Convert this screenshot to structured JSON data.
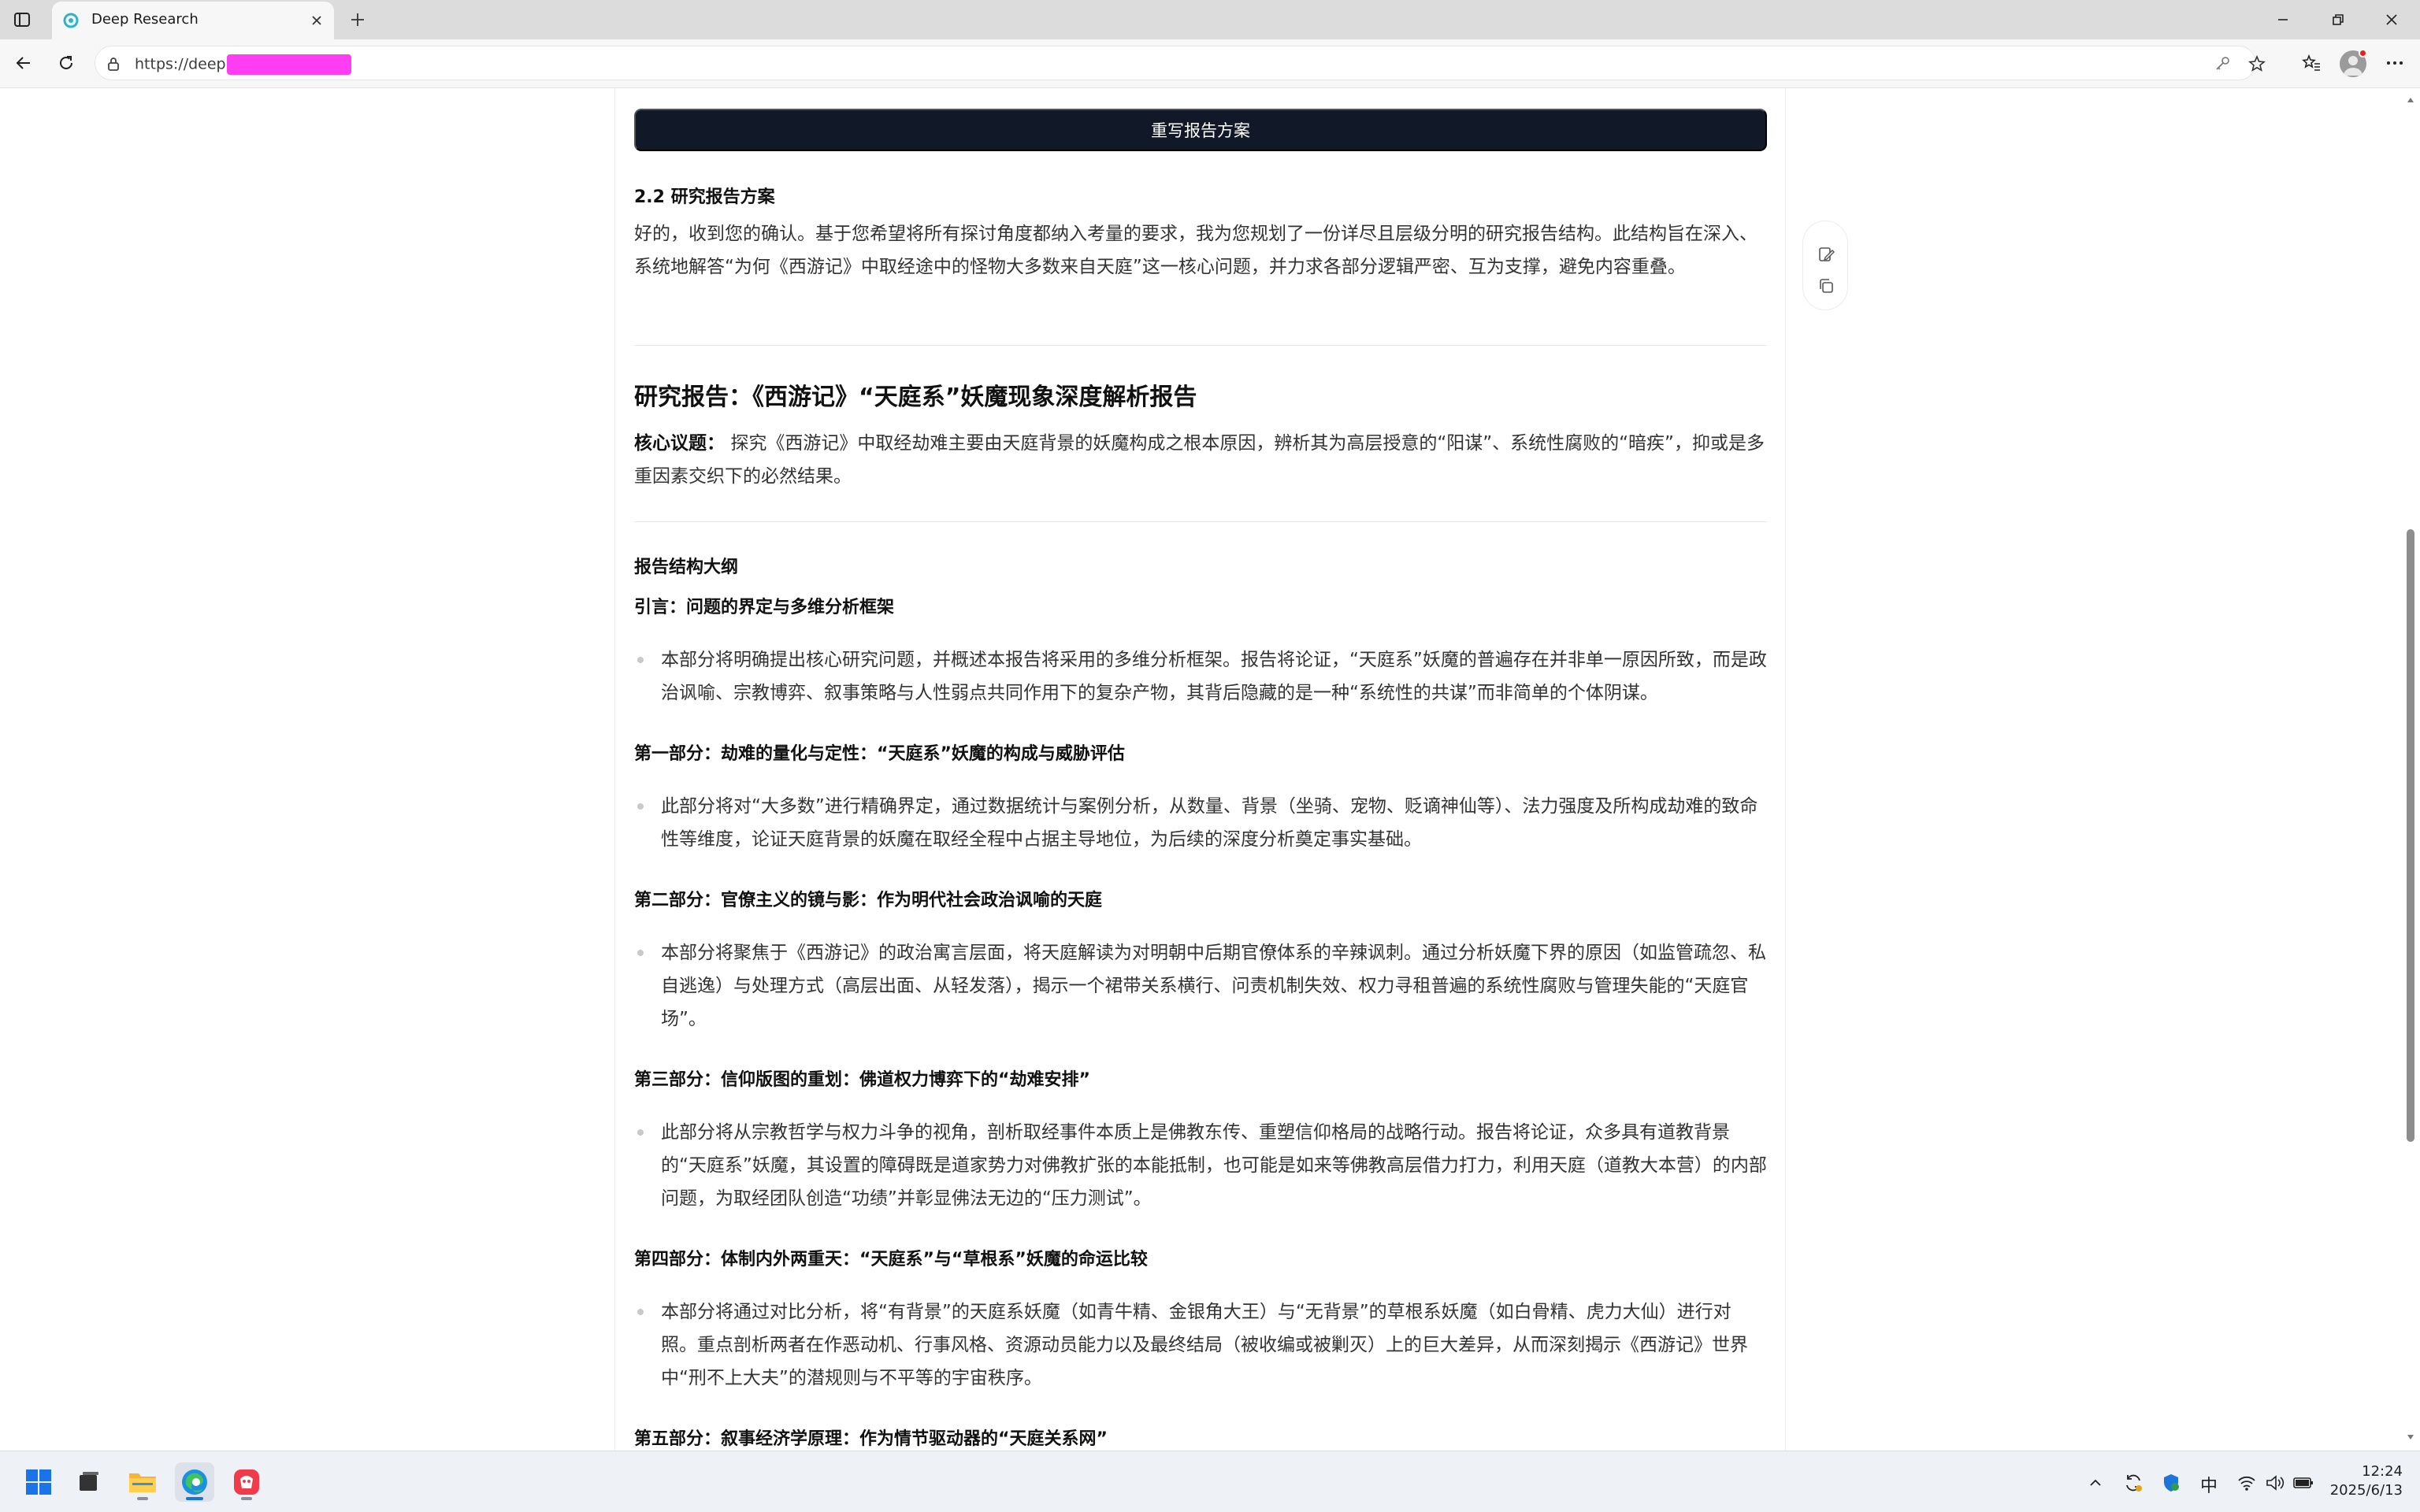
{
  "browser": {
    "tab_title": "Deep Research",
    "url_prefix": "https://deep",
    "icons": [
      "tab-actions-icon",
      "tab-favicon",
      "close-icon",
      "plus-icon",
      "minimize-icon",
      "restore-icon",
      "window-close-icon",
      "back-arrow-icon",
      "refresh-icon",
      "lock-icon",
      "key-icon",
      "star-icon",
      "favorites-icon",
      "profile-avatar",
      "more-icon"
    ]
  },
  "page": {
    "rewrite_button": "重写报告方案",
    "section_heading": "2.2 研究报告方案",
    "intro_paragraph": "好的，收到您的确认。基于您希望将所有探讨角度都纳入考量的要求，我为您规划了一份详尽且层级分明的研究报告结构。此结构旨在深入、系统地解答“为何《西游记》中取经途中的怪物大多数来自天庭”这一核心问题，并力求各部分逻辑严密、互为支撑，避免内容重叠。",
    "report_title": "研究报告：《西游记》“天庭系”妖魔现象深度解析报告",
    "core_label": "核心议题：",
    "core_text": "探究《西游记》中取经劫难主要由天庭背景的妖魔构成之根本原因，辨析其为高层授意的“阳谋”、系统性腐败的“暗疾”，抑或是多重因素交织下的必然结果。",
    "outline_heading": "报告结构大纲",
    "sections": [
      {
        "heading": "引言：问题的界定与多维分析框架",
        "bullet": "本部分将明确提出核心研究问题，并概述本报告将采用的多维分析框架。报告将论证，“天庭系”妖魔的普遍存在并非单一原因所致，而是政治讽喻、宗教博弈、叙事策略与人性弱点共同作用下的复杂产物，其背后隐藏的是一种“系统性的共谋”而非简单的个体阴谋。"
      },
      {
        "heading": "第一部分：劫难的量化与定性：“天庭系”妖魔的构成与威胁评估",
        "bullet": "此部分将对“大多数”进行精确界定，通过数据统计与案例分析，从数量、背景（坐骑、宠物、贬谪神仙等）、法力强度及所构成劫难的致命性等维度，论证天庭背景的妖魔在取经全程中占据主导地位，为后续的深度分析奠定事实基础。"
      },
      {
        "heading": "第二部分：官僚主义的镜与影：作为明代社会政治讽喻的天庭",
        "bullet": "本部分将聚焦于《西游记》的政治寓言层面，将天庭解读为对明朝中后期官僚体系的辛辣讽刺。通过分析妖魔下界的原因（如监管疏忽、私自逃逸）与处理方式（高层出面、从轻发落），揭示一个裙带关系横行、问责机制失效、权力寻租普遍的系统性腐败与管理失能的“天庭官场”。"
      },
      {
        "heading": "第三部分：信仰版图的重划：佛道权力博弈下的“劫难安排”",
        "bullet": "此部分将从宗教哲学与权力斗争的视角，剖析取经事件本质上是佛教东传、重塑信仰格局的战略行动。报告将论证，众多具有道教背景的“天庭系”妖魔，其设置的障碍既是道家势力对佛教扩张的本能抵制，也可能是如来等佛教高层借力打力，利用天庭（道教大本营）的内部问题，为取经团队创造“功绩”并彰显佛法无边的“压力测试”。"
      },
      {
        "heading": "第四部分：体制内外两重天：“天庭系”与“草根系”妖魔的命运比较",
        "bullet": "本部分将通过对比分析，将“有背景”的天庭系妖魔（如青牛精、金银角大王）与“无背景”的草根系妖魔（如白骨精、虎力大仙）进行对照。重点剖析两者在作恶动机、行事风格、资源动员能力以及最终结局（被收编或被剿灭）上的巨大差异，从而深刻揭示《西游记》世界中“刑不上大夫”的潜规则与不平等的宇宙秩序。"
      },
      {
        "heading": "第五部分：叙事经济学原理：作为情节驱动器的“天庭关系网”"
      }
    ],
    "side_tool_icons": [
      "edit-icon",
      "copy-icon"
    ]
  },
  "taskbar": {
    "apps": [
      "windows-start-icon",
      "task-view-icon",
      "file-explorer-icon",
      "edge-browser-icon",
      "app-icon"
    ],
    "ime": "中",
    "time": "12:24",
    "date": "2025/6/13"
  }
}
